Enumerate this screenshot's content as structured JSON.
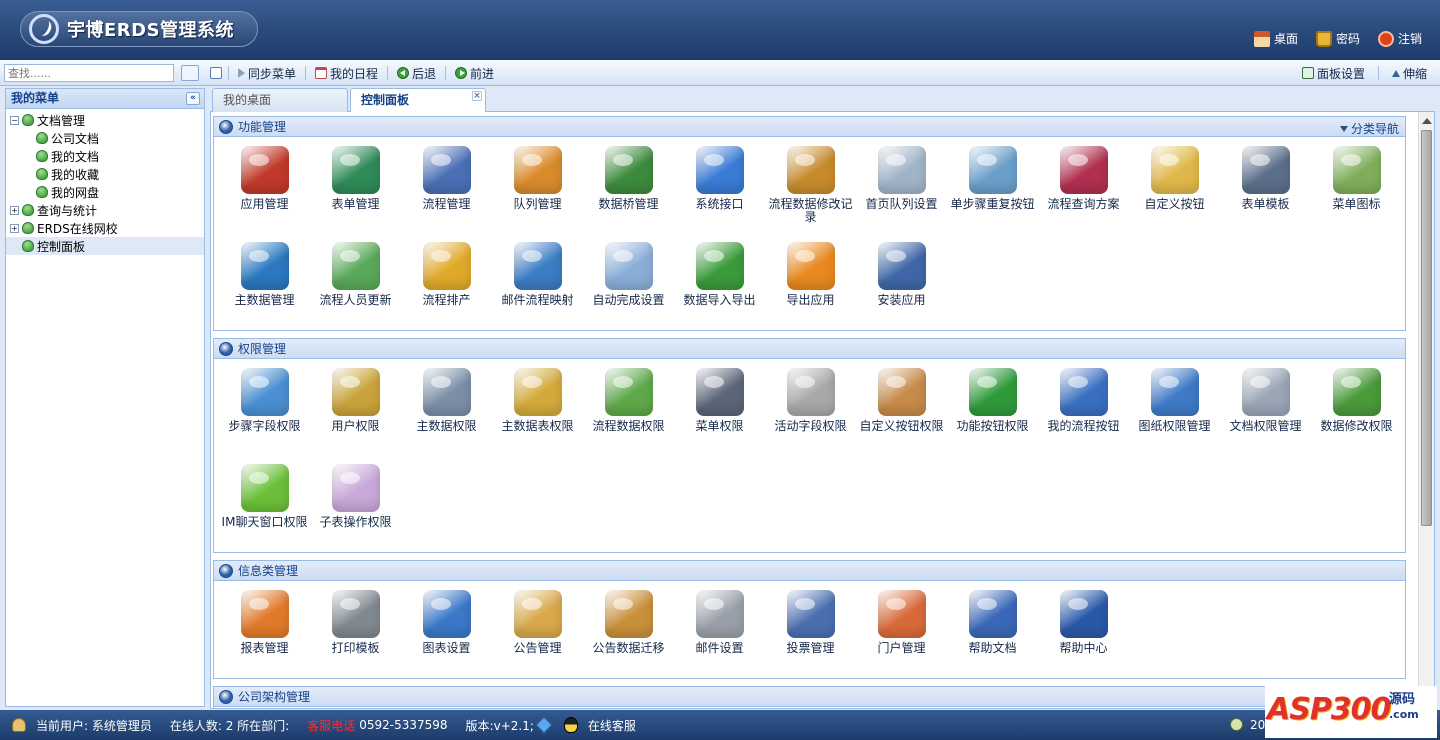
{
  "header": {
    "title": "宇博ERDS管理系统",
    "links": [
      {
        "label": "桌面",
        "icon": "house-icon"
      },
      {
        "label": "密码",
        "icon": "lock-icon"
      },
      {
        "label": "注销",
        "icon": "power-icon"
      }
    ]
  },
  "toolbar": {
    "search_placeholder": "查找......",
    "sync_menu": "同步菜单",
    "my_schedule": "我的日程",
    "back": "后退",
    "forward": "前进",
    "panel_settings": "面板设置",
    "shrink": "伸缩"
  },
  "sidebar": {
    "title": "我的菜单",
    "tree": [
      {
        "label": "文档管理",
        "level": 0,
        "expander": "−"
      },
      {
        "label": "公司文档",
        "level": 1
      },
      {
        "label": "我的文档",
        "level": 1
      },
      {
        "label": "我的收藏",
        "level": 1
      },
      {
        "label": "我的网盘",
        "level": 1
      },
      {
        "label": "查询与统计",
        "level": 0,
        "expander": "+"
      },
      {
        "label": "ERDS在线网校",
        "level": 0,
        "expander": "+"
      },
      {
        "label": "控制面板",
        "level": 0,
        "selected": true
      }
    ]
  },
  "tabs": {
    "desktop": "我的桌面",
    "control_panel": "控制面板",
    "close_glyph": "×"
  },
  "panels": [
    {
      "title": "功能管理",
      "nav": "分类导航",
      "items": [
        {
          "label": "应用管理",
          "color": "#c0392b"
        },
        {
          "label": "表单管理",
          "color": "#2e8b57"
        },
        {
          "label": "流程管理",
          "color": "#4a6fb5"
        },
        {
          "label": "队列管理",
          "color": "#d98a2b"
        },
        {
          "label": "数据桥管理",
          "color": "#3d8a3d"
        },
        {
          "label": "系统接口",
          "color": "#3a7bd5"
        },
        {
          "label": "流程数据修改记录",
          "color": "#c78b2d"
        },
        {
          "label": "首页队列设置",
          "color": "#a0b4c8"
        },
        {
          "label": "单步骤重复按钮",
          "color": "#6a9fc9"
        },
        {
          "label": "流程查询方案",
          "color": "#b03050"
        },
        {
          "label": "自定义按钮",
          "color": "#e0b84a"
        },
        {
          "label": "表单模板",
          "color": "#5b6f8a"
        },
        {
          "label": "菜单图标",
          "color": "#7fae5a"
        },
        {
          "label": "主数据管理",
          "color": "#2a78c0"
        },
        {
          "label": "流程人员更新",
          "color": "#5aa85a"
        },
        {
          "label": "流程排产",
          "color": "#e0a92a"
        },
        {
          "label": "邮件流程映射",
          "color": "#3b7cc4"
        },
        {
          "label": "自动完成设置",
          "color": "#8aaed8"
        },
        {
          "label": "数据导入导出",
          "color": "#3a9b3a"
        },
        {
          "label": "导出应用",
          "color": "#e8891f"
        },
        {
          "label": "安装应用",
          "color": "#3f67a8"
        }
      ]
    },
    {
      "title": "权限管理",
      "items": [
        {
          "label": "步骤字段权限",
          "color": "#4a8fd1"
        },
        {
          "label": "用户权限",
          "color": "#c9a33a"
        },
        {
          "label": "主数据权限",
          "color": "#7a8ea8"
        },
        {
          "label": "主数据表权限",
          "color": "#d3a93a"
        },
        {
          "label": "流程数据权限",
          "color": "#5fa84a"
        },
        {
          "label": "菜单权限",
          "color": "#5b6678"
        },
        {
          "label": "活动字段权限",
          "color": "#a8a8a8"
        },
        {
          "label": "自定义按钮权限",
          "color": "#c68a4a"
        },
        {
          "label": "功能按钮权限",
          "color": "#2f9a3a"
        },
        {
          "label": "我的流程按钮",
          "color": "#3a6fc0"
        },
        {
          "label": "图纸权限管理",
          "color": "#3f7ac6"
        },
        {
          "label": "文档权限管理",
          "color": "#9aa6b6"
        },
        {
          "label": "数据修改权限",
          "color": "#4a9a3a"
        },
        {
          "label": "IM聊天窗口权限",
          "color": "#6cbf3a"
        },
        {
          "label": "子表操作权限",
          "color": "#c8a8d8"
        }
      ]
    },
    {
      "title": "信息类管理",
      "items": [
        {
          "label": "报表管理",
          "color": "#e07a2a"
        },
        {
          "label": "打印模板",
          "color": "#808890"
        },
        {
          "label": "图表设置",
          "color": "#3a78c8"
        },
        {
          "label": "公告管理",
          "color": "#d8a84a"
        },
        {
          "label": "公告数据迁移",
          "color": "#c8903a"
        },
        {
          "label": "邮件设置",
          "color": "#9aa0aa"
        },
        {
          "label": "投票管理",
          "color": "#4a6fb0"
        },
        {
          "label": "门户管理",
          "color": "#d86a3a"
        },
        {
          "label": "帮助文档",
          "color": "#3a68b8"
        },
        {
          "label": "帮助中心",
          "color": "#2a58a8"
        }
      ]
    },
    {
      "title": "公司架构管理",
      "items": []
    }
  ],
  "footer": {
    "current_user": "当前用户: 系统管理员",
    "online_count": "在线人数: 2 所在部门:",
    "phone_label": "客服电话",
    "phone": "0592-5337598",
    "version": "版本:v+2.1;",
    "online_service": "在线客服",
    "clock_text": "201"
  },
  "watermark": {
    "brand": "ASP300",
    "yuanma": "源码",
    "com": ".com"
  }
}
